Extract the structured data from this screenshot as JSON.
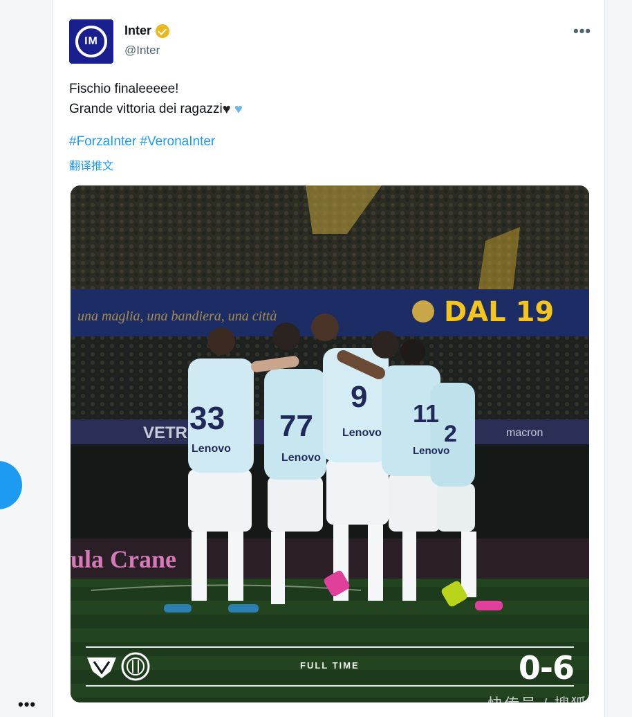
{
  "tweet": {
    "display_name": "Inter",
    "handle": "@Inter",
    "avatar_text": "IM",
    "more_icon": "•••",
    "text_line1": "Fischio finaleeeee!",
    "text_line2": "Grande vittoria dei ragazzi",
    "emoji_heart_black": "♥",
    "emoji_heart_blue": "♥",
    "hashtags": [
      "#ForzaInter",
      "#VeronaInter"
    ],
    "translate_label": "翻译推文"
  },
  "media": {
    "banner_text": "DAL 19",
    "banner_motto": "una maglia, una bandiera, una città",
    "ad_text": "VETR",
    "ad_text_right": "macron",
    "board_text": "ula Crane",
    "jersey_numbers": [
      "33",
      "77",
      "9",
      "11",
      "2"
    ],
    "sponsor": "Lenovo",
    "full_time_label": "FULL TIME",
    "score": "0-6",
    "home_crest_icon": "verona-crest-icon",
    "away_crest_icon": "inter-crest-icon"
  },
  "sidebar": {
    "more_label": "•••"
  },
  "watermark": "快传号 / 搜狐",
  "colors": {
    "link": "#1d9bf0",
    "inter_blue": "#1a1f8f",
    "verified_gold": "#e8b923",
    "banner_yellow": "#f3c51d"
  }
}
